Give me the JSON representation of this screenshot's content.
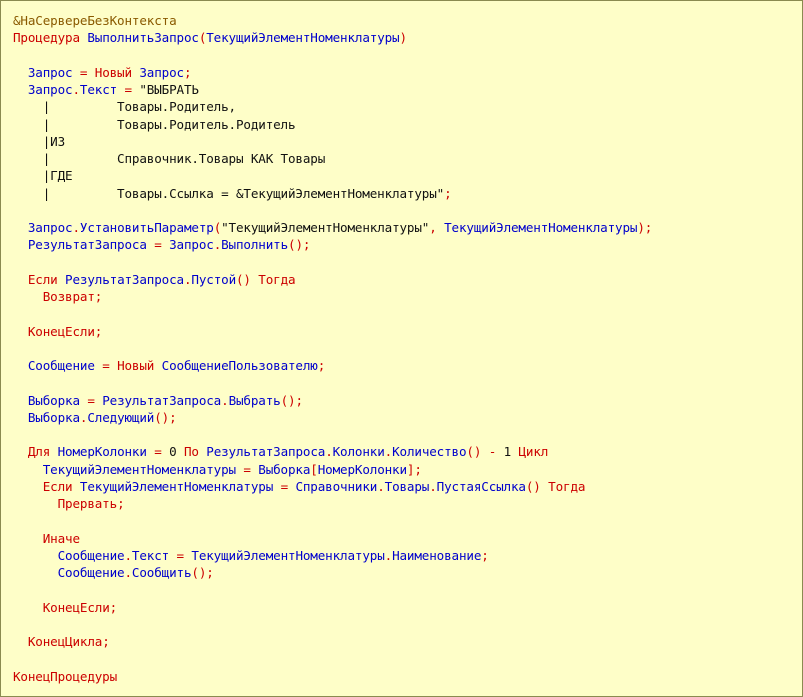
{
  "editor": {
    "lines": [
      [
        {
          "t": "&НаСервереБезКонтекста",
          "k": "pp"
        }
      ],
      [
        {
          "t": "Процедура ",
          "k": "kw"
        },
        {
          "t": "ВыполнитьЗапрос",
          "k": "id"
        },
        {
          "t": "(",
          "k": "op"
        },
        {
          "t": "ТекущийЭлементНоменклатуры",
          "k": "id"
        },
        {
          "t": ")",
          "k": "op"
        }
      ],
      [],
      [
        {
          "t": "  ",
          "k": "id"
        },
        {
          "t": "Запрос",
          "k": "id"
        },
        {
          "t": " = ",
          "k": "op"
        },
        {
          "t": "Новый ",
          "k": "kw"
        },
        {
          "t": "Запрос",
          "k": "id"
        },
        {
          "t": ";",
          "k": "op"
        }
      ],
      [
        {
          "t": "  ",
          "k": "id"
        },
        {
          "t": "Запрос",
          "k": "id"
        },
        {
          "t": ".",
          "k": "op"
        },
        {
          "t": "Текст",
          "k": "id"
        },
        {
          "t": " = ",
          "k": "op"
        },
        {
          "t": "\"ВЫБРАТЬ",
          "k": "str"
        }
      ],
      [
        {
          "t": "    |         Товары.Родитель,",
          "k": "str"
        }
      ],
      [
        {
          "t": "    |         Товары.Родитель.Родитель",
          "k": "str"
        }
      ],
      [
        {
          "t": "    |ИЗ",
          "k": "str"
        }
      ],
      [
        {
          "t": "    |         Справочник.Товары КАК Товары",
          "k": "str"
        }
      ],
      [
        {
          "t": "    |ГДЕ",
          "k": "str"
        }
      ],
      [
        {
          "t": "    |         Товары.Ссылка = &ТекущийЭлементНоменклатуры\"",
          "k": "str"
        },
        {
          "t": ";",
          "k": "op"
        }
      ],
      [],
      [
        {
          "t": "  ",
          "k": "id"
        },
        {
          "t": "Запрос",
          "k": "id"
        },
        {
          "t": ".",
          "k": "op"
        },
        {
          "t": "УстановитьПараметр",
          "k": "id"
        },
        {
          "t": "(",
          "k": "op"
        },
        {
          "t": "\"ТекущийЭлементНоменклатуры\"",
          "k": "str"
        },
        {
          "t": ", ",
          "k": "op"
        },
        {
          "t": "ТекущийЭлементНоменклатуры",
          "k": "id"
        },
        {
          "t": ");",
          "k": "op"
        }
      ],
      [
        {
          "t": "  ",
          "k": "id"
        },
        {
          "t": "РезультатЗапроса",
          "k": "id"
        },
        {
          "t": " = ",
          "k": "op"
        },
        {
          "t": "Запрос",
          "k": "id"
        },
        {
          "t": ".",
          "k": "op"
        },
        {
          "t": "Выполнить",
          "k": "id"
        },
        {
          "t": "();",
          "k": "op"
        }
      ],
      [],
      [
        {
          "t": "  ",
          "k": "id"
        },
        {
          "t": "Если ",
          "k": "kw"
        },
        {
          "t": "РезультатЗапроса",
          "k": "id"
        },
        {
          "t": ".",
          "k": "op"
        },
        {
          "t": "Пустой",
          "k": "id"
        },
        {
          "t": "() ",
          "k": "op"
        },
        {
          "t": "Тогда",
          "k": "kw"
        }
      ],
      [
        {
          "t": "    ",
          "k": "id"
        },
        {
          "t": "Возврат",
          "k": "kw"
        },
        {
          "t": ";",
          "k": "op"
        }
      ],
      [],
      [
        {
          "t": "  ",
          "k": "id"
        },
        {
          "t": "КонецЕсли",
          "k": "kw"
        },
        {
          "t": ";",
          "k": "op"
        }
      ],
      [],
      [
        {
          "t": "  ",
          "k": "id"
        },
        {
          "t": "Сообщение",
          "k": "id"
        },
        {
          "t": " = ",
          "k": "op"
        },
        {
          "t": "Новый ",
          "k": "kw"
        },
        {
          "t": "СообщениеПользователю",
          "k": "id"
        },
        {
          "t": ";",
          "k": "op"
        }
      ],
      [],
      [
        {
          "t": "  ",
          "k": "id"
        },
        {
          "t": "Выборка",
          "k": "id"
        },
        {
          "t": " = ",
          "k": "op"
        },
        {
          "t": "РезультатЗапроса",
          "k": "id"
        },
        {
          "t": ".",
          "k": "op"
        },
        {
          "t": "Выбрать",
          "k": "id"
        },
        {
          "t": "();",
          "k": "op"
        }
      ],
      [
        {
          "t": "  ",
          "k": "id"
        },
        {
          "t": "Выборка",
          "k": "id"
        },
        {
          "t": ".",
          "k": "op"
        },
        {
          "t": "Следующий",
          "k": "id"
        },
        {
          "t": "();",
          "k": "op"
        }
      ],
      [],
      [
        {
          "t": "  ",
          "k": "id"
        },
        {
          "t": "Для ",
          "k": "kw"
        },
        {
          "t": "НомерКолонки",
          "k": "id"
        },
        {
          "t": " = ",
          "k": "op"
        },
        {
          "t": "0 ",
          "k": "str"
        },
        {
          "t": "По ",
          "k": "kw"
        },
        {
          "t": "РезультатЗапроса",
          "k": "id"
        },
        {
          "t": ".",
          "k": "op"
        },
        {
          "t": "Колонки",
          "k": "id"
        },
        {
          "t": ".",
          "k": "op"
        },
        {
          "t": "Количество",
          "k": "id"
        },
        {
          "t": "() - ",
          "k": "op"
        },
        {
          "t": "1 ",
          "k": "str"
        },
        {
          "t": "Цикл",
          "k": "kw"
        }
      ],
      [
        {
          "t": "    ",
          "k": "id"
        },
        {
          "t": "ТекущийЭлементНоменклатуры",
          "k": "id"
        },
        {
          "t": " = ",
          "k": "op"
        },
        {
          "t": "Выборка",
          "k": "id"
        },
        {
          "t": "[",
          "k": "op"
        },
        {
          "t": "НомерКолонки",
          "k": "id"
        },
        {
          "t": "];",
          "k": "op"
        }
      ],
      [
        {
          "t": "    ",
          "k": "id"
        },
        {
          "t": "Если ",
          "k": "kw"
        },
        {
          "t": "ТекущийЭлементНоменклатуры",
          "k": "id"
        },
        {
          "t": " = ",
          "k": "op"
        },
        {
          "t": "Справочники",
          "k": "id"
        },
        {
          "t": ".",
          "k": "op"
        },
        {
          "t": "Товары",
          "k": "id"
        },
        {
          "t": ".",
          "k": "op"
        },
        {
          "t": "ПустаяСсылка",
          "k": "id"
        },
        {
          "t": "() ",
          "k": "op"
        },
        {
          "t": "Тогда",
          "k": "kw"
        }
      ],
      [
        {
          "t": "      ",
          "k": "id"
        },
        {
          "t": "Прервать",
          "k": "kw"
        },
        {
          "t": ";",
          "k": "op"
        }
      ],
      [],
      [
        {
          "t": "    ",
          "k": "id"
        },
        {
          "t": "Иначе",
          "k": "kw"
        }
      ],
      [
        {
          "t": "      ",
          "k": "id"
        },
        {
          "t": "Сообщение",
          "k": "id"
        },
        {
          "t": ".",
          "k": "op"
        },
        {
          "t": "Текст",
          "k": "id"
        },
        {
          "t": " = ",
          "k": "op"
        },
        {
          "t": "ТекущийЭлементНоменклатуры",
          "k": "id"
        },
        {
          "t": ".",
          "k": "op"
        },
        {
          "t": "Наименование",
          "k": "id"
        },
        {
          "t": ";",
          "k": "op"
        }
      ],
      [
        {
          "t": "      ",
          "k": "id"
        },
        {
          "t": "Сообщение",
          "k": "id"
        },
        {
          "t": ".",
          "k": "op"
        },
        {
          "t": "Сообщить",
          "k": "id"
        },
        {
          "t": "();",
          "k": "op"
        }
      ],
      [],
      [
        {
          "t": "    ",
          "k": "id"
        },
        {
          "t": "КонецЕсли",
          "k": "kw"
        },
        {
          "t": ";",
          "k": "op"
        }
      ],
      [],
      [
        {
          "t": "  ",
          "k": "id"
        },
        {
          "t": "КонецЦикла",
          "k": "kw"
        },
        {
          "t": ";",
          "k": "op"
        }
      ],
      [],
      [
        {
          "t": "КонецПроцедуры",
          "k": "kw"
        }
      ]
    ],
    "colors": {
      "background": "#fefec8",
      "keyword": "#cc0000",
      "identifier": "#0000cc",
      "string": "#111111",
      "preprocessor": "#8a5a00"
    }
  }
}
